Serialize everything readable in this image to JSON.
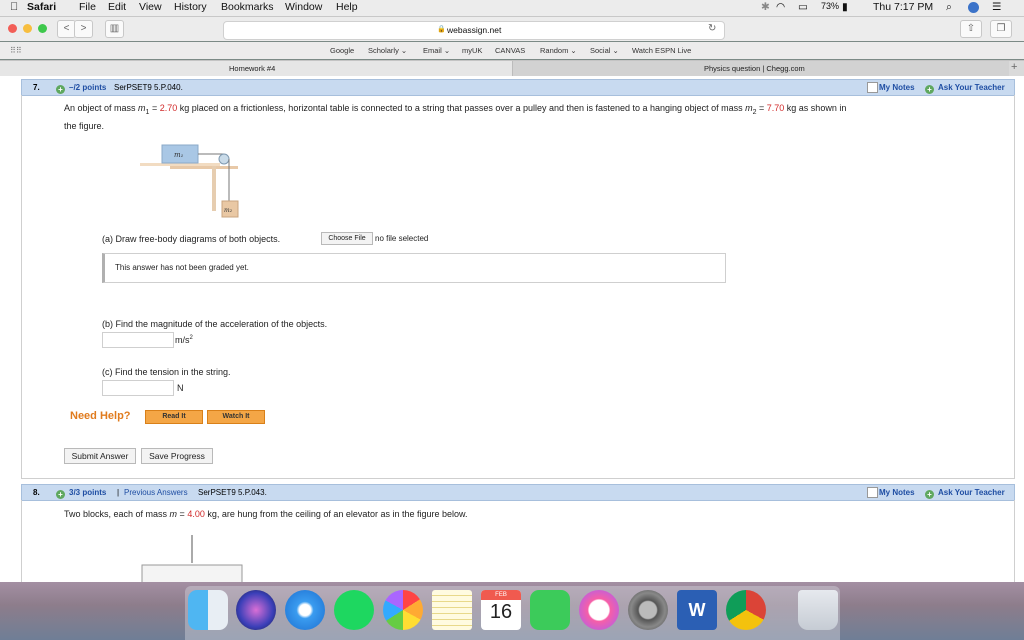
{
  "menubar": {
    "apple": "",
    "app": "Safari",
    "items": [
      "File",
      "Edit",
      "View",
      "History",
      "Bookmarks",
      "Window",
      "Help"
    ],
    "battery": "73%",
    "clock": "Thu 7:17 PM"
  },
  "browser": {
    "url": "webassign.net",
    "bookmarks": [
      "Google",
      "Scholarly ⌄",
      "Email ⌄",
      "myUK",
      "CANVAS",
      "Random ⌄",
      "Social ⌄",
      "Watch ESPN Live"
    ],
    "tabs": [
      "Homework #4",
      "Physics question | Chegg.com"
    ],
    "new_tab": "+"
  },
  "question7": {
    "number": "7.",
    "points": "–/2 points",
    "code": "SerPSET9 5.P.040.",
    "my_notes": "My Notes",
    "ask_teacher": "Ask Your Teacher",
    "stmt_a": "An object of mass ",
    "m1_sym": "m",
    "m1_sub": "1",
    "eq1": " = ",
    "m1_val": "2.70",
    "stmt_b": " kg placed on a frictionless, horizontal table is connected to a string that passes over a pulley and then is fastened to a hanging object of mass ",
    "m2_sym": "m",
    "m2_sub": "2",
    "eq2": " = ",
    "m2_val": "7.70",
    "stmt_c": " kg as shown in",
    "stmt_line2": "the figure.",
    "fig_m1": "m₁",
    "fig_m2": "m₂",
    "part_a": "(a) Draw free-body diagrams of both objects.",
    "choose_file": "Choose File",
    "no_file": "no file selected",
    "not_graded": "This answer has not been graded yet.",
    "part_b": "(b) Find the magnitude of the acceleration of the objects.",
    "unit_b": "m/s",
    "unit_b_sup": "2",
    "part_c": "(c) Find the tension in the string.",
    "unit_c": "N",
    "need_help": "Need Help?",
    "read_it": "Read It",
    "watch_it": "Watch It",
    "submit": "Submit Answer",
    "save": "Save Progress"
  },
  "question8": {
    "number": "8.",
    "points": "3/3 points",
    "separator": "|",
    "prev": "Previous Answers",
    "code": "SerPSET9 5.P.043.",
    "my_notes": "My Notes",
    "ask_teacher": "Ask Your Teacher",
    "stmt_a": "Two blocks, each of mass ",
    "m_sym": "m",
    "eq": " = ",
    "m_val": "4.00",
    "stmt_b": " kg,  are hung from the ceiling of an elevator as in the figure below."
  },
  "dock": {
    "calendar_month": "FEB",
    "calendar_day": "16",
    "apps": [
      "finder",
      "siri",
      "safari",
      "spotify",
      "photos",
      "notes",
      "calendar",
      "facetime",
      "itunes",
      "system-preferences",
      "word",
      "chrome",
      "trash"
    ]
  }
}
